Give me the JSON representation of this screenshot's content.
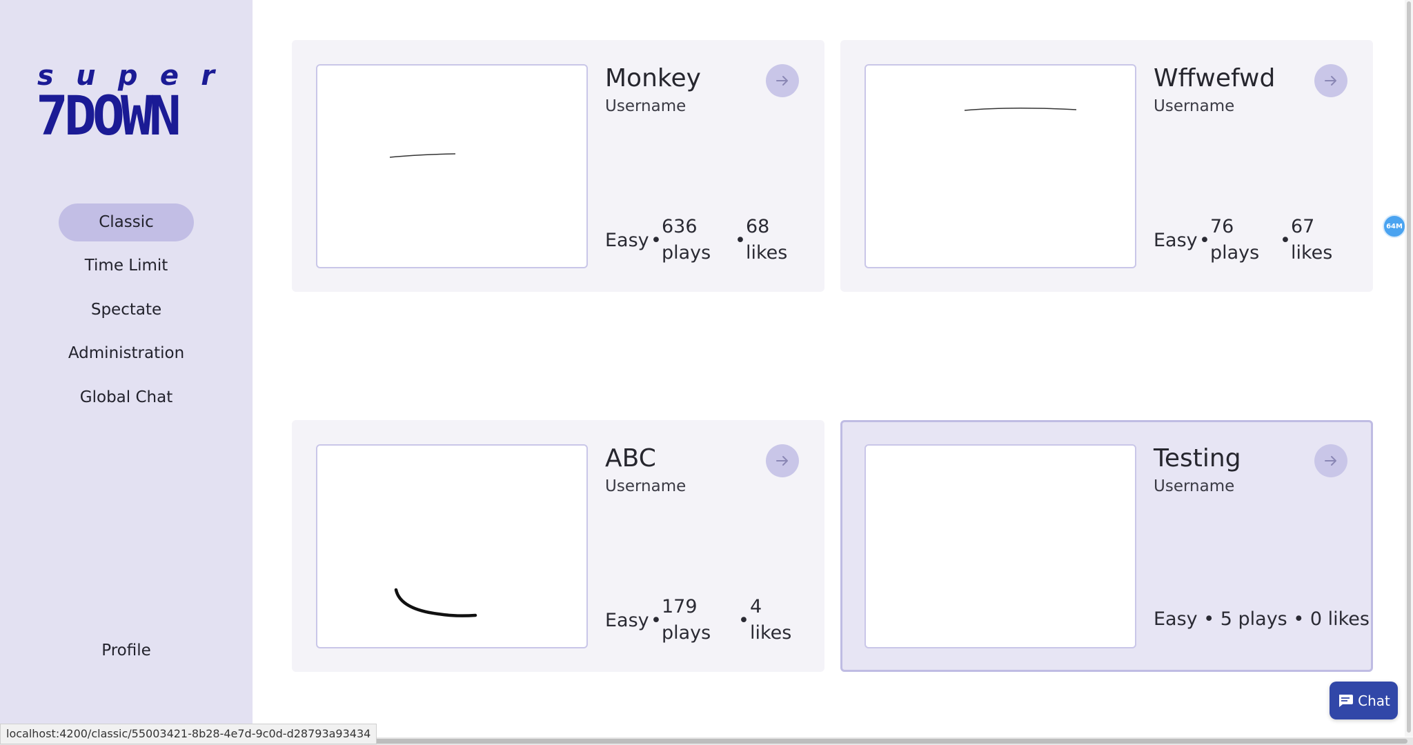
{
  "logo": {
    "super_letters": [
      "s",
      "u",
      "p",
      "e",
      "r"
    ],
    "down_text": "7DOWN"
  },
  "sidebar": {
    "items": [
      {
        "label": "Classic",
        "active": true
      },
      {
        "label": "Time Limit",
        "active": false
      },
      {
        "label": "Spectate",
        "active": false
      },
      {
        "label": "Administration",
        "active": false
      },
      {
        "label": "Global Chat",
        "active": false
      }
    ],
    "profile_label": "Profile"
  },
  "games": [
    {
      "title": "Monkey",
      "username": "Username",
      "difficulty": "Easy",
      "plays_num": "636",
      "plays_word": "plays",
      "likes_num": "68",
      "likes_word": "likes",
      "stats_line": "",
      "arrow_icon": "arrow-right-icon"
    },
    {
      "title": "Wffwefwd",
      "username": "Username",
      "difficulty": "Easy",
      "plays_num": "76",
      "plays_word": "plays",
      "likes_num": "67",
      "likes_word": "likes",
      "stats_line": "",
      "arrow_icon": "arrow-right-icon"
    },
    {
      "title": "ABC",
      "username": "Username",
      "difficulty": "Easy",
      "plays_num": "179",
      "plays_word": "plays",
      "likes_num": "4",
      "likes_word": "likes",
      "stats_line": "",
      "arrow_icon": "arrow-right-icon"
    },
    {
      "title": "Testing",
      "username": "Username",
      "difficulty": "Easy",
      "stats_line": "Easy • 5 plays • 0 likes",
      "selected": true,
      "arrow_icon": "arrow-right-icon"
    }
  ],
  "status_bar": {
    "url": "localhost:4200/classic/55003421-8b28-4e7d-9c0d-d28793a93434"
  },
  "memory_badge": {
    "label": "64M"
  },
  "chat_button": {
    "label": "Chat",
    "icon": "chat-bubble-icon"
  },
  "colors": {
    "sidebar_bg": "#e3e1f2",
    "active_pill": "#c2bee5",
    "logo_blue": "#1b1b95",
    "card_bg": "#f4f3f8",
    "chat_blue": "#3147a8",
    "badge_blue": "#4aa3f0"
  }
}
